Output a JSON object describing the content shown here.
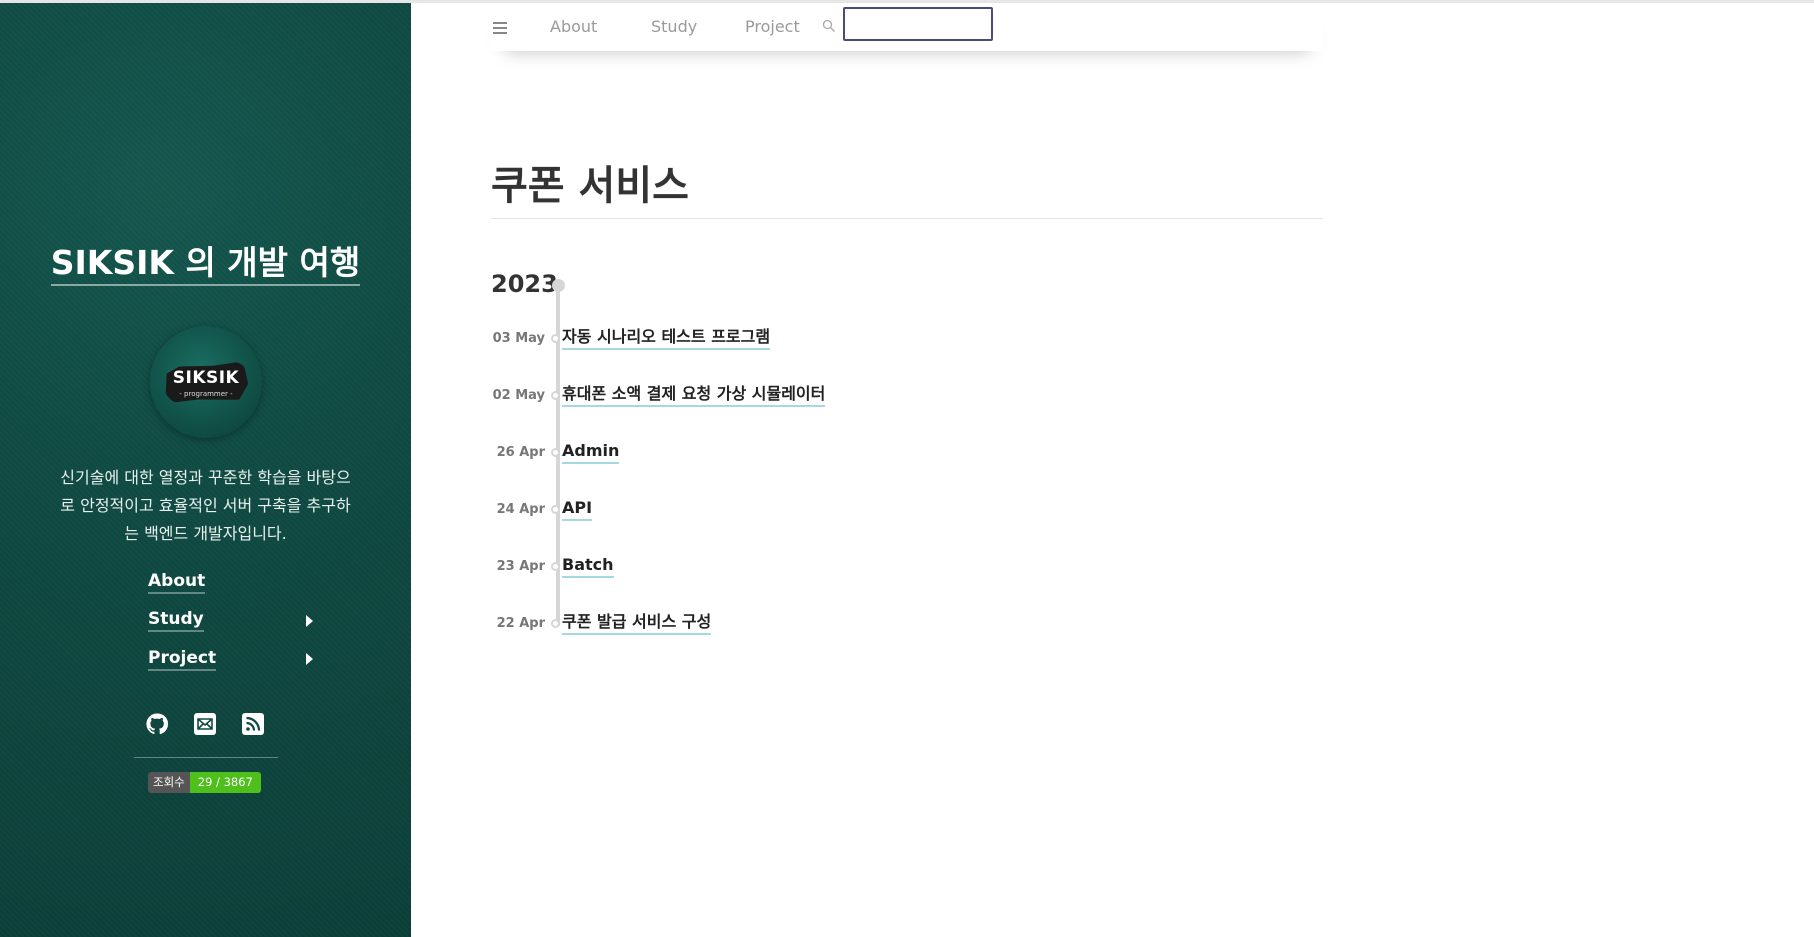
{
  "sidebar": {
    "site_title": "SIKSIK 의 개발 여행",
    "avatar": {
      "logo_text": "SIKSIK",
      "logo_sub": "- programmer -"
    },
    "bio": "신기술에 대한 열정과 꾸준한 학습을 바탕으로 안정적이고 효율적인 서버 구축을 추구하는 백엔드 개발자입니다.",
    "nav": [
      {
        "label": "About",
        "has_submenu": false
      },
      {
        "label": "Study",
        "has_submenu": true
      },
      {
        "label": "Project",
        "has_submenu": true
      }
    ],
    "social_icons": [
      "github-icon",
      "email-icon",
      "rss-icon"
    ],
    "hits_badge": {
      "key": "조회수",
      "value": "29 / 3867",
      "color": "#4fbf1c"
    },
    "background_color": "#0f4a42"
  },
  "topbar": {
    "menu_icon": "hamburger-icon",
    "links": [
      "About",
      "Study",
      "Project"
    ],
    "search_icon": "search-icon",
    "search_value": ""
  },
  "main": {
    "title": "쿠폰 서비스",
    "year": "2023",
    "posts": [
      {
        "date": "03 May",
        "title": "자동 시나리오 테스트 프로그램"
      },
      {
        "date": "02 May",
        "title": "휴대폰 소액 결제 요청 가상 시뮬레이터"
      },
      {
        "date": "26 Apr",
        "title": "Admin"
      },
      {
        "date": "24 Apr",
        "title": "API"
      },
      {
        "date": "23 Apr",
        "title": "Batch"
      },
      {
        "date": "22 Apr",
        "title": "쿠폰 발급 서비스 구성"
      }
    ],
    "link_underline_color": "#a6d8de"
  }
}
